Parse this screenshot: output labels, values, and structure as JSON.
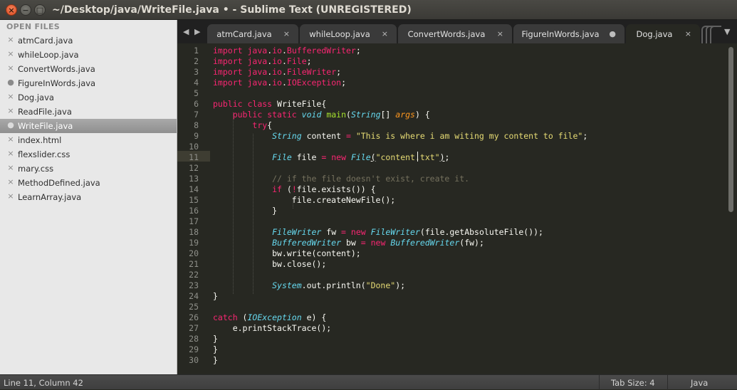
{
  "window": {
    "title": "~/Desktop/java/WriteFile.java • - Sublime Text (UNREGISTERED)",
    "close_glyph": "×",
    "minimize_glyph": "−",
    "maximize_glyph": "□"
  },
  "sidebar": {
    "header": "OPEN FILES",
    "items": [
      {
        "label": "atmCard.java",
        "marker": "×"
      },
      {
        "label": "whileLoop.java",
        "marker": "×"
      },
      {
        "label": "ConvertWords.java",
        "marker": "×"
      },
      {
        "label": "FigureInWords.java",
        "marker": "●"
      },
      {
        "label": "Dog.java",
        "marker": "×"
      },
      {
        "label": "ReadFile.java",
        "marker": "×"
      },
      {
        "label": "WriteFile.java",
        "marker": "●",
        "selected": true
      },
      {
        "label": "index.html",
        "marker": "×"
      },
      {
        "label": "flexslider.css",
        "marker": "×"
      },
      {
        "label": "mary.css",
        "marker": "×"
      },
      {
        "label": "MethodDefined.java",
        "marker": "×"
      },
      {
        "label": "LearnArray.java",
        "marker": "×"
      }
    ]
  },
  "tabs": {
    "nav_left": "◀",
    "nav_right": "▶",
    "menu": "▼",
    "items": [
      {
        "label": "atmCard.java",
        "close": "×"
      },
      {
        "label": "whileLoop.java",
        "close": "×"
      },
      {
        "label": "ConvertWords.java",
        "close": "×"
      },
      {
        "label": "FigureInWords.java",
        "close": "●"
      },
      {
        "label": "Dog.java",
        "close": "×"
      }
    ]
  },
  "editor": {
    "line_numbers": [
      "1",
      "2",
      "3",
      "4",
      "5",
      "6",
      "7",
      "8",
      "9",
      "10",
      "11",
      "12",
      "13",
      "14",
      "15",
      "16",
      "17",
      "18",
      "19",
      "20",
      "21",
      "22",
      "23",
      "24",
      "25",
      "26",
      "27",
      "28",
      "29",
      "30"
    ],
    "current_line": "11",
    "language": "Java"
  },
  "theme": {
    "background": "#272822",
    "keyword": "#f92672",
    "type": "#66d9ef",
    "string": "#e6db74",
    "parameter": "#fd971f",
    "function": "#a6e22e",
    "comment": "#75715e"
  },
  "status": {
    "position": "Line 11, Column 42",
    "tab_size": "Tab Size: 4",
    "syntax": "Java"
  }
}
